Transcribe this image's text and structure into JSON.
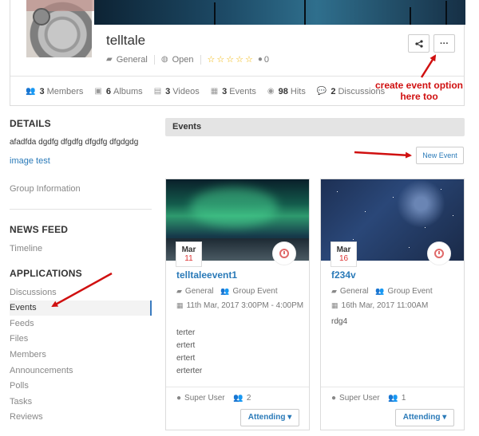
{
  "group": {
    "title": "telltale",
    "category": "General",
    "privacy": "Open",
    "rating_stars": "☆☆☆☆☆",
    "rating_count": "0",
    "share_icon": "share-icon",
    "more_label": "···",
    "stats": [
      {
        "icon": "members-icon",
        "glyph": "👥",
        "count": "3",
        "label": "Members"
      },
      {
        "icon": "albums-icon",
        "glyph": "▣",
        "count": "6",
        "label": "Albums"
      },
      {
        "icon": "videos-icon",
        "glyph": "▤",
        "count": "3",
        "label": "Videos"
      },
      {
        "icon": "events-icon",
        "glyph": "▦",
        "count": "3",
        "label": "Events"
      },
      {
        "icon": "hits-icon",
        "glyph": "◉",
        "count": "98",
        "label": "Hits"
      },
      {
        "icon": "discussions-icon",
        "glyph": "💬",
        "count": "2",
        "label": "Discussions"
      }
    ]
  },
  "sidebar": {
    "details_heading": "DETAILS",
    "details_text": "afadfda dgdfg dfgdfg dfgdfg dfgdgdg",
    "image_test_link": "image test",
    "group_info": "Group Information",
    "news_heading": "NEWS FEED",
    "timeline": "Timeline",
    "apps_heading": "APPLICATIONS",
    "apps": [
      "Discussions",
      "Events",
      "Feeds",
      "Files",
      "Members",
      "Announcements",
      "Polls",
      "Tasks",
      "Reviews"
    ],
    "active_app": "Events"
  },
  "main": {
    "section_title": "Events",
    "new_event_label": "New Event",
    "events": [
      {
        "title": "telltaleevent1",
        "month": "Mar",
        "day": "11",
        "category": "General",
        "type": "Group Event",
        "time": "11th Mar, 2017 3:00PM - 4:00PM",
        "description": [
          "terter",
          "ertert",
          "ertert",
          "erterter"
        ],
        "host": "Super User",
        "guests": "2",
        "rsvp": "Attending ▾"
      },
      {
        "title": "f234v",
        "month": "Mar",
        "day": "16",
        "category": "General",
        "type": "Group Event",
        "time": "16th Mar, 2017 11:00AM",
        "description": [
          "rdg4"
        ],
        "host": "Super User",
        "guests": "1",
        "rsvp": "Attending ▾"
      }
    ]
  },
  "annotations": {
    "note_line1": "create event option",
    "note_line2": "here too",
    "color": "#d01010"
  }
}
